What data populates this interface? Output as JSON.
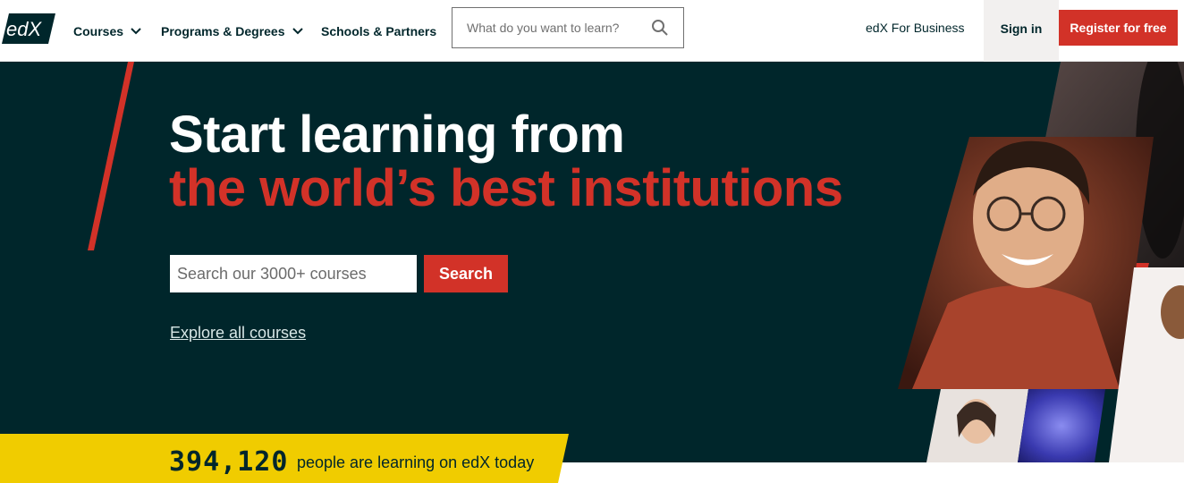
{
  "colors": {
    "brand_dark": "#00262b",
    "accent_red": "#d23228",
    "highlight_yellow": "#f0cc00",
    "signin_bg": "#f2f0ef"
  },
  "header": {
    "logo_text": "edX",
    "nav": {
      "courses": "Courses",
      "programs": "Programs & Degrees",
      "schools": "Schools & Partners"
    },
    "search_placeholder": "What do you want to learn?",
    "business_link": "edX For Business",
    "sign_in": "Sign in",
    "register": "Register for free"
  },
  "hero": {
    "title_line1": "Start learning from",
    "title_line2": "the world’s best institutions",
    "search_placeholder": "Search our 3000+ courses",
    "search_button": "Search",
    "explore_link": "Explore all courses"
  },
  "counter": {
    "number": "394,120",
    "text": "people are learning on edX today"
  }
}
